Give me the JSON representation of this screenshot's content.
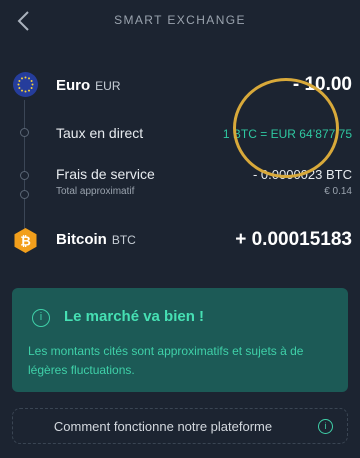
{
  "header": {
    "title": "SMART EXCHANGE",
    "back_icon": "chevron-left-icon"
  },
  "from": {
    "name": "Euro",
    "code": "EUR",
    "amount": "- 10.00",
    "icon": "eu-flag-icon"
  },
  "rate": {
    "label": "Taux en direct",
    "value": "1 BTC = EUR 64’877.75"
  },
  "fee": {
    "label": "Frais de service",
    "value": "- 0.0000023 BTC",
    "sub_label": "Total approximatif",
    "sub_value": "€ 0.14"
  },
  "to": {
    "name": "Bitcoin",
    "code": "BTC",
    "amount": "+ 0.00015183",
    "icon": "bitcoin-icon"
  },
  "notice": {
    "title": "Le marché va bien !",
    "text": "Les montants cités sont approximatifs et sujets à de légères fluctuations.",
    "icon": "info-icon"
  },
  "how_it_works": {
    "label": "Comment fonctionne notre plateforme",
    "icon": "info-icon"
  },
  "colors": {
    "background": "#1c2431",
    "accent": "#2fc7a0",
    "notice_bg": "#1c5a56",
    "highlight": "#d8a93a"
  }
}
